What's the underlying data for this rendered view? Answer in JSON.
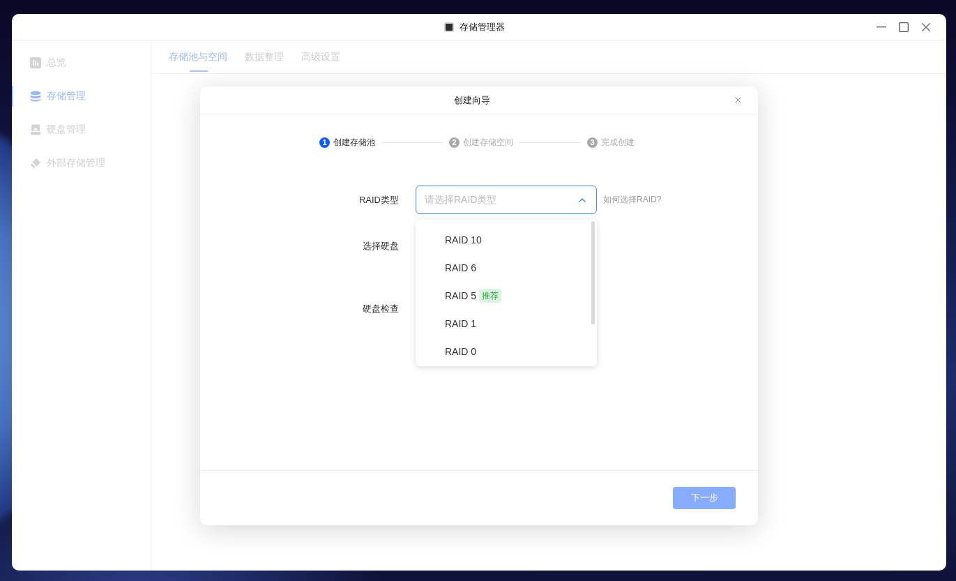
{
  "window": {
    "title": "存储管理器"
  },
  "sidebar": {
    "items": [
      {
        "kind": "overview",
        "label": "总览",
        "selected": false
      },
      {
        "kind": "storage",
        "label": "存储管理",
        "selected": true
      },
      {
        "kind": "disk",
        "label": "硬盘管理",
        "selected": false
      },
      {
        "kind": "external",
        "label": "外部存储管理",
        "selected": false
      }
    ]
  },
  "tabs": [
    {
      "label": "存储池与空间",
      "selected": true
    },
    {
      "label": "数据整理",
      "selected": false
    },
    {
      "label": "高级设置",
      "selected": false
    }
  ],
  "dialog": {
    "title": "创建向导",
    "steps": [
      {
        "number": "1",
        "label": "创建存储池",
        "selected": true
      },
      {
        "number": "2",
        "label": "创建存储空间",
        "selected": false
      },
      {
        "number": "3",
        "label": "完成创建",
        "selected": false
      }
    ],
    "form_rows": [
      {
        "kind": "select",
        "label": "RAID类型",
        "placeholder": "请选择RAID类型",
        "expanded": true,
        "help": "如何选择RAID?",
        "options": [
          {
            "label": "RAID 10"
          },
          {
            "label": "RAID 6"
          },
          {
            "label": "RAID 5",
            "badge": "推荐"
          },
          {
            "label": "RAID 1"
          },
          {
            "label": "RAID 0"
          }
        ]
      },
      {
        "kind": "plain",
        "label": "选择硬盘"
      },
      {
        "kind": "plain",
        "label": "硬盘检查"
      }
    ],
    "next_button": {
      "label": "下一步",
      "disabled": true
    }
  }
}
